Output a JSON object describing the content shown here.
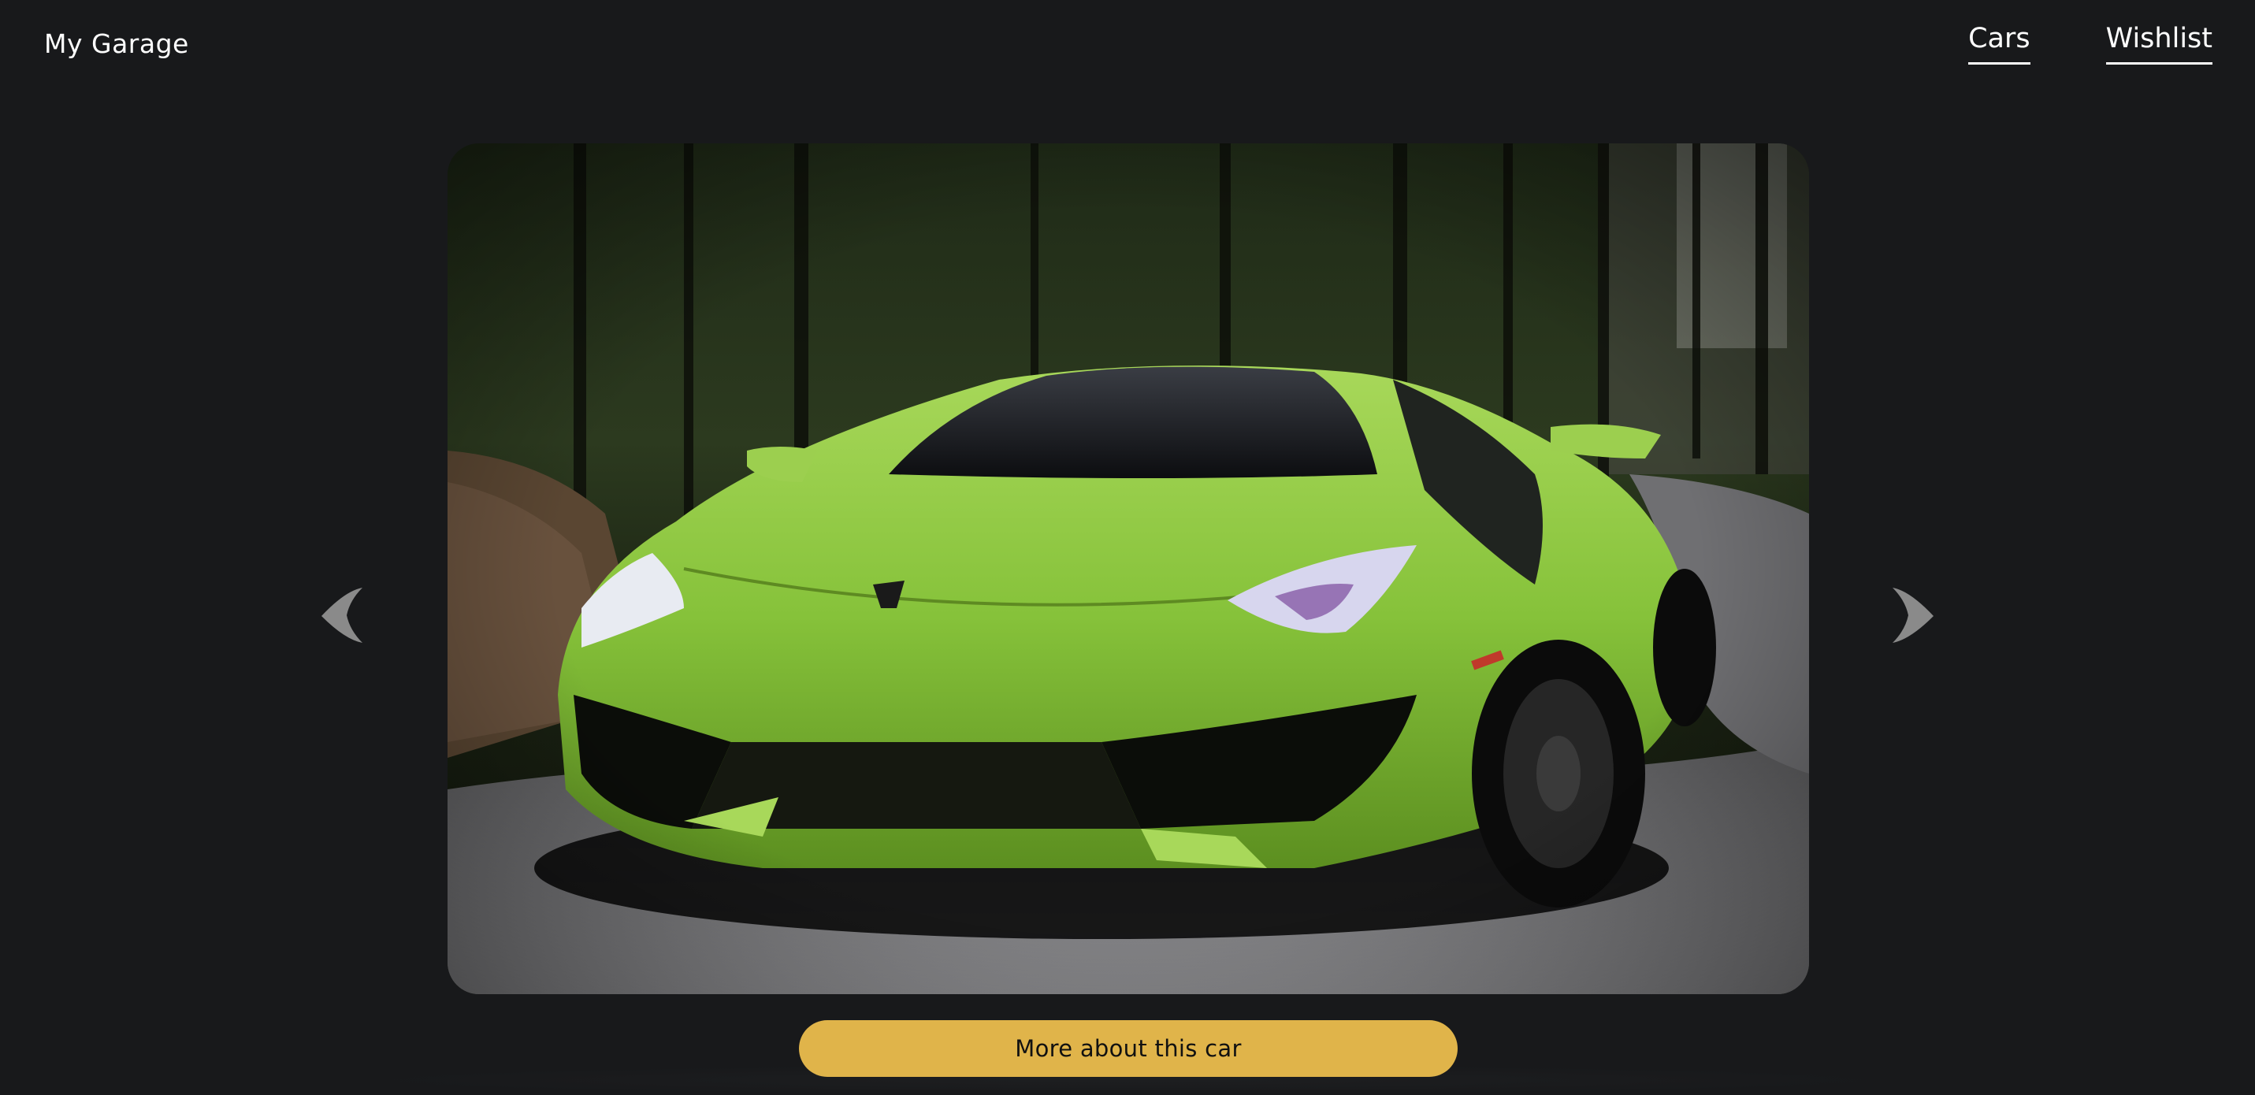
{
  "header": {
    "brand": "My Garage",
    "nav": [
      {
        "label": "Cars"
      },
      {
        "label": "Wishlist"
      }
    ]
  },
  "carousel": {
    "image_subject": "green sports car on forest road",
    "prev_icon": "chevron-left-icon",
    "next_icon": "chevron-right-icon"
  },
  "cta": {
    "label": "More about this car"
  },
  "colors": {
    "background": "#18191b",
    "accent": "#e0b44a",
    "text": "#ffffff",
    "arrow": "#8a8a8a",
    "car": "#8cc63f"
  }
}
